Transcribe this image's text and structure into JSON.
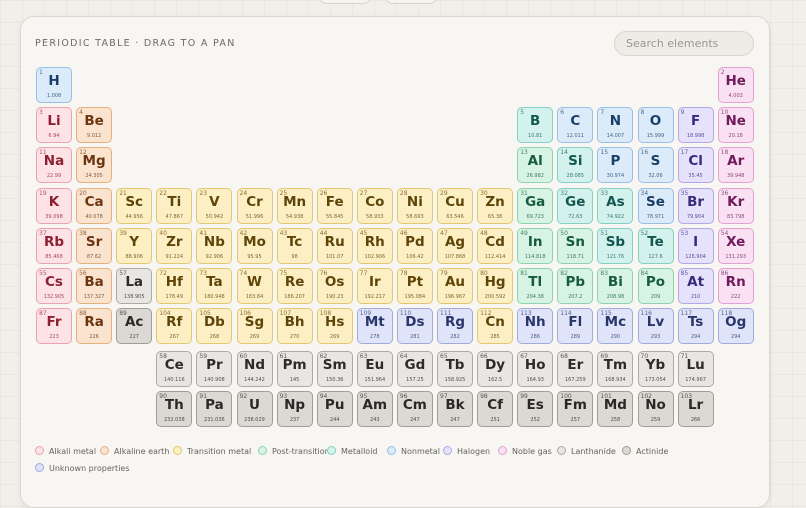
{
  "panel": {
    "title": "PERIODIC TABLE · DRAG TO A PAN"
  },
  "search": {
    "placeholder": "Search elements"
  },
  "categories": {
    "alkali": {
      "label": "Alkali metal",
      "bg": "#fde3e6",
      "border": "#eba3ad",
      "text": "#8f1f33"
    },
    "alkaline": {
      "label": "Alkaline earth",
      "bg": "#fbe4cf",
      "border": "#e3b07f",
      "text": "#6a3510"
    },
    "transition": {
      "label": "Transition metal",
      "bg": "#fbefc3",
      "border": "#e2c874",
      "text": "#5f4408"
    },
    "post": {
      "label": "Post-transition",
      "bg": "#d6f3e3",
      "border": "#8fd3ad",
      "text": "#175c3a"
    },
    "metalloid": {
      "label": "Metalloid",
      "bg": "#d3f2ed",
      "border": "#85cfc3",
      "text": "#135650"
    },
    "nonmetal": {
      "label": "Nonmetal",
      "bg": "#dcebfa",
      "border": "#99bfe3",
      "text": "#1a3f66"
    },
    "halogen": {
      "label": "Halogen",
      "bg": "#e6e2fb",
      "border": "#b1a6e6",
      "text": "#392a7c"
    },
    "noble": {
      "label": "Noble gas",
      "bg": "#f9e1f3",
      "border": "#e0a2d1",
      "text": "#701a5c"
    },
    "lanthanide": {
      "label": "Lanthanide",
      "bg": "#e8e6e2",
      "border": "#aeaaa3",
      "text": "#2d2b28"
    },
    "actinide": {
      "label": "Actinide",
      "bg": "#dcd9d4",
      "border": "#a19d96",
      "text": "#2a2825"
    },
    "unknown": {
      "label": "Unknown properties",
      "bg": "#dfe4f8",
      "border": "#9eabdc",
      "text": "#29366c"
    }
  },
  "legend_order": [
    "alkali",
    "alkaline",
    "transition",
    "post",
    "metalloid",
    "nonmetal",
    "halogen",
    "noble",
    "lanthanide",
    "actinide",
    "unknown"
  ],
  "elements": [
    {
      "n": "1",
      "s": "H",
      "m": "1.008",
      "c": "nonmetal",
      "g": 1,
      "p": 1
    },
    {
      "n": "2",
      "s": "He",
      "m": "4.003",
      "c": "noble",
      "g": 18,
      "p": 1
    },
    {
      "n": "3",
      "s": "Li",
      "m": "6.94",
      "c": "alkali",
      "g": 1,
      "p": 2
    },
    {
      "n": "4",
      "s": "Be",
      "m": "9.012",
      "c": "alkaline",
      "g": 2,
      "p": 2
    },
    {
      "n": "5",
      "s": "B",
      "m": "10.81",
      "c": "metalloid",
      "g": 13,
      "p": 2
    },
    {
      "n": "6",
      "s": "C",
      "m": "12.011",
      "c": "nonmetal",
      "g": 14,
      "p": 2
    },
    {
      "n": "7",
      "s": "N",
      "m": "14.007",
      "c": "nonmetal",
      "g": 15,
      "p": 2
    },
    {
      "n": "8",
      "s": "O",
      "m": "15.999",
      "c": "nonmetal",
      "g": 16,
      "p": 2
    },
    {
      "n": "9",
      "s": "F",
      "m": "18.998",
      "c": "halogen",
      "g": 17,
      "p": 2
    },
    {
      "n": "10",
      "s": "Ne",
      "m": "20.18",
      "c": "noble",
      "g": 18,
      "p": 2
    },
    {
      "n": "11",
      "s": "Na",
      "m": "22.99",
      "c": "alkali",
      "g": 1,
      "p": 3
    },
    {
      "n": "12",
      "s": "Mg",
      "m": "24.305",
      "c": "alkaline",
      "g": 2,
      "p": 3
    },
    {
      "n": "13",
      "s": "Al",
      "m": "26.982",
      "c": "post",
      "g": 13,
      "p": 3
    },
    {
      "n": "14",
      "s": "Si",
      "m": "28.085",
      "c": "metalloid",
      "g": 14,
      "p": 3
    },
    {
      "n": "15",
      "s": "P",
      "m": "30.974",
      "c": "nonmetal",
      "g": 15,
      "p": 3
    },
    {
      "n": "16",
      "s": "S",
      "m": "32.06",
      "c": "nonmetal",
      "g": 16,
      "p": 3
    },
    {
      "n": "17",
      "s": "Cl",
      "m": "35.45",
      "c": "halogen",
      "g": 17,
      "p": 3
    },
    {
      "n": "18",
      "s": "Ar",
      "m": "39.948",
      "c": "noble",
      "g": 18,
      "p": 3
    },
    {
      "n": "19",
      "s": "K",
      "m": "39.098",
      "c": "alkali",
      "g": 1,
      "p": 4
    },
    {
      "n": "20",
      "s": "Ca",
      "m": "40.078",
      "c": "alkaline",
      "g": 2,
      "p": 4
    },
    {
      "n": "21",
      "s": "Sc",
      "m": "44.956",
      "c": "transition",
      "g": 3,
      "p": 4
    },
    {
      "n": "22",
      "s": "Ti",
      "m": "47.867",
      "c": "transition",
      "g": 4,
      "p": 4
    },
    {
      "n": "23",
      "s": "V",
      "m": "50.942",
      "c": "transition",
      "g": 5,
      "p": 4
    },
    {
      "n": "24",
      "s": "Cr",
      "m": "51.996",
      "c": "transition",
      "g": 6,
      "p": 4
    },
    {
      "n": "25",
      "s": "Mn",
      "m": "54.938",
      "c": "transition",
      "g": 7,
      "p": 4
    },
    {
      "n": "26",
      "s": "Fe",
      "m": "55.845",
      "c": "transition",
      "g": 8,
      "p": 4
    },
    {
      "n": "27",
      "s": "Co",
      "m": "58.933",
      "c": "transition",
      "g": 9,
      "p": 4
    },
    {
      "n": "28",
      "s": "Ni",
      "m": "58.693",
      "c": "transition",
      "g": 10,
      "p": 4
    },
    {
      "n": "29",
      "s": "Cu",
      "m": "63.546",
      "c": "transition",
      "g": 11,
      "p": 4
    },
    {
      "n": "30",
      "s": "Zn",
      "m": "65.38",
      "c": "transition",
      "g": 12,
      "p": 4
    },
    {
      "n": "31",
      "s": "Ga",
      "m": "69.723",
      "c": "post",
      "g": 13,
      "p": 4
    },
    {
      "n": "32",
      "s": "Ge",
      "m": "72.63",
      "c": "metalloid",
      "g": 14,
      "p": 4
    },
    {
      "n": "33",
      "s": "As",
      "m": "74.922",
      "c": "metalloid",
      "g": 15,
      "p": 4
    },
    {
      "n": "34",
      "s": "Se",
      "m": "78.971",
      "c": "nonmetal",
      "g": 16,
      "p": 4
    },
    {
      "n": "35",
      "s": "Br",
      "m": "79.904",
      "c": "halogen",
      "g": 17,
      "p": 4
    },
    {
      "n": "36",
      "s": "Kr",
      "m": "83.798",
      "c": "noble",
      "g": 18,
      "p": 4
    },
    {
      "n": "37",
      "s": "Rb",
      "m": "85.468",
      "c": "alkali",
      "g": 1,
      "p": 5
    },
    {
      "n": "38",
      "s": "Sr",
      "m": "87.62",
      "c": "alkaline",
      "g": 2,
      "p": 5
    },
    {
      "n": "39",
      "s": "Y",
      "m": "88.906",
      "c": "transition",
      "g": 3,
      "p": 5
    },
    {
      "n": "40",
      "s": "Zr",
      "m": "91.224",
      "c": "transition",
      "g": 4,
      "p": 5
    },
    {
      "n": "41",
      "s": "Nb",
      "m": "92.906",
      "c": "transition",
      "g": 5,
      "p": 5
    },
    {
      "n": "42",
      "s": "Mo",
      "m": "95.95",
      "c": "transition",
      "g": 6,
      "p": 5
    },
    {
      "n": "43",
      "s": "Tc",
      "m": "98",
      "c": "transition",
      "g": 7,
      "p": 5
    },
    {
      "n": "44",
      "s": "Ru",
      "m": "101.07",
      "c": "transition",
      "g": 8,
      "p": 5
    },
    {
      "n": "45",
      "s": "Rh",
      "m": "102.906",
      "c": "transition",
      "g": 9,
      "p": 5
    },
    {
      "n": "46",
      "s": "Pd",
      "m": "106.42",
      "c": "transition",
      "g": 10,
      "p": 5
    },
    {
      "n": "47",
      "s": "Ag",
      "m": "107.868",
      "c": "transition",
      "g": 11,
      "p": 5
    },
    {
      "n": "48",
      "s": "Cd",
      "m": "112.414",
      "c": "transition",
      "g": 12,
      "p": 5
    },
    {
      "n": "49",
      "s": "In",
      "m": "114.818",
      "c": "post",
      "g": 13,
      "p": 5
    },
    {
      "n": "50",
      "s": "Sn",
      "m": "118.71",
      "c": "post",
      "g": 14,
      "p": 5
    },
    {
      "n": "51",
      "s": "Sb",
      "m": "121.76",
      "c": "metalloid",
      "g": 15,
      "p": 5
    },
    {
      "n": "52",
      "s": "Te",
      "m": "127.6",
      "c": "metalloid",
      "g": 16,
      "p": 5
    },
    {
      "n": "53",
      "s": "I",
      "m": "126.904",
      "c": "halogen",
      "g": 17,
      "p": 5
    },
    {
      "n": "54",
      "s": "Xe",
      "m": "131.293",
      "c": "noble",
      "g": 18,
      "p": 5
    },
    {
      "n": "55",
      "s": "Cs",
      "m": "132.905",
      "c": "alkali",
      "g": 1,
      "p": 6
    },
    {
      "n": "56",
      "s": "Ba",
      "m": "137.327",
      "c": "alkaline",
      "g": 2,
      "p": 6
    },
    {
      "n": "57",
      "s": "La",
      "m": "138.905",
      "c": "lanthanide",
      "g": 3,
      "p": 6
    },
    {
      "n": "72",
      "s": "Hf",
      "m": "178.49",
      "c": "transition",
      "g": 4,
      "p": 6
    },
    {
      "n": "73",
      "s": "Ta",
      "m": "180.948",
      "c": "transition",
      "g": 5,
      "p": 6
    },
    {
      "n": "74",
      "s": "W",
      "m": "183.84",
      "c": "transition",
      "g": 6,
      "p": 6
    },
    {
      "n": "75",
      "s": "Re",
      "m": "186.207",
      "c": "transition",
      "g": 7,
      "p": 6
    },
    {
      "n": "76",
      "s": "Os",
      "m": "190.23",
      "c": "transition",
      "g": 8,
      "p": 6
    },
    {
      "n": "77",
      "s": "Ir",
      "m": "192.217",
      "c": "transition",
      "g": 9,
      "p": 6
    },
    {
      "n": "78",
      "s": "Pt",
      "m": "195.084",
      "c": "transition",
      "g": 10,
      "p": 6
    },
    {
      "n": "79",
      "s": "Au",
      "m": "196.967",
      "c": "transition",
      "g": 11,
      "p": 6
    },
    {
      "n": "80",
      "s": "Hg",
      "m": "200.592",
      "c": "transition",
      "g": 12,
      "p": 6
    },
    {
      "n": "81",
      "s": "Tl",
      "m": "204.38",
      "c": "post",
      "g": 13,
      "p": 6
    },
    {
      "n": "82",
      "s": "Pb",
      "m": "207.2",
      "c": "post",
      "g": 14,
      "p": 6
    },
    {
      "n": "83",
      "s": "Bi",
      "m": "208.98",
      "c": "post",
      "g": 15,
      "p": 6
    },
    {
      "n": "84",
      "s": "Po",
      "m": "209",
      "c": "post",
      "g": 16,
      "p": 6
    },
    {
      "n": "85",
      "s": "At",
      "m": "210",
      "c": "halogen",
      "g": 17,
      "p": 6
    },
    {
      "n": "86",
      "s": "Rn",
      "m": "222",
      "c": "noble",
      "g": 18,
      "p": 6
    },
    {
      "n": "87",
      "s": "Fr",
      "m": "223",
      "c": "alkali",
      "g": 1,
      "p": 7
    },
    {
      "n": "88",
      "s": "Ra",
      "m": "226",
      "c": "alkaline",
      "g": 2,
      "p": 7
    },
    {
      "n": "89",
      "s": "Ac",
      "m": "227",
      "c": "actinide",
      "g": 3,
      "p": 7
    },
    {
      "n": "104",
      "s": "Rf",
      "m": "267",
      "c": "transition",
      "g": 4,
      "p": 7
    },
    {
      "n": "105",
      "s": "Db",
      "m": "268",
      "c": "transition",
      "g": 5,
      "p": 7
    },
    {
      "n": "106",
      "s": "Sg",
      "m": "269",
      "c": "transition",
      "g": 6,
      "p": 7
    },
    {
      "n": "107",
      "s": "Bh",
      "m": "270",
      "c": "transition",
      "g": 7,
      "p": 7
    },
    {
      "n": "108",
      "s": "Hs",
      "m": "269",
      "c": "transition",
      "g": 8,
      "p": 7
    },
    {
      "n": "109",
      "s": "Mt",
      "m": "278",
      "c": "unknown",
      "g": 9,
      "p": 7
    },
    {
      "n": "110",
      "s": "Ds",
      "m": "281",
      "c": "unknown",
      "g": 10,
      "p": 7
    },
    {
      "n": "111",
      "s": "Rg",
      "m": "282",
      "c": "unknown",
      "g": 11,
      "p": 7
    },
    {
      "n": "112",
      "s": "Cn",
      "m": "285",
      "c": "transition",
      "g": 12,
      "p": 7
    },
    {
      "n": "113",
      "s": "Nh",
      "m": "286",
      "c": "unknown",
      "g": 13,
      "p": 7
    },
    {
      "n": "114",
      "s": "Fl",
      "m": "289",
      "c": "unknown",
      "g": 14,
      "p": 7
    },
    {
      "n": "115",
      "s": "Mc",
      "m": "290",
      "c": "unknown",
      "g": 15,
      "p": 7
    },
    {
      "n": "116",
      "s": "Lv",
      "m": "293",
      "c": "unknown",
      "g": 16,
      "p": 7
    },
    {
      "n": "117",
      "s": "Ts",
      "m": "294",
      "c": "unknown",
      "g": 17,
      "p": 7
    },
    {
      "n": "118",
      "s": "Og",
      "m": "294",
      "c": "unknown",
      "g": 18,
      "p": 7
    },
    {
      "n": "58",
      "s": "Ce",
      "m": "140.116",
      "c": "lanthanide",
      "g": 4,
      "p": 8
    },
    {
      "n": "59",
      "s": "Pr",
      "m": "140.908",
      "c": "lanthanide",
      "g": 5,
      "p": 8
    },
    {
      "n": "60",
      "s": "Nd",
      "m": "144.242",
      "c": "lanthanide",
      "g": 6,
      "p": 8
    },
    {
      "n": "61",
      "s": "Pm",
      "m": "145",
      "c": "lanthanide",
      "g": 7,
      "p": 8
    },
    {
      "n": "62",
      "s": "Sm",
      "m": "150.36",
      "c": "lanthanide",
      "g": 8,
      "p": 8
    },
    {
      "n": "63",
      "s": "Eu",
      "m": "151.964",
      "c": "lanthanide",
      "g": 9,
      "p": 8
    },
    {
      "n": "64",
      "s": "Gd",
      "m": "157.25",
      "c": "lanthanide",
      "g": 10,
      "p": 8
    },
    {
      "n": "65",
      "s": "Tb",
      "m": "158.925",
      "c": "lanthanide",
      "g": 11,
      "p": 8
    },
    {
      "n": "66",
      "s": "Dy",
      "m": "162.5",
      "c": "lanthanide",
      "g": 12,
      "p": 8
    },
    {
      "n": "67",
      "s": "Ho",
      "m": "164.93",
      "c": "lanthanide",
      "g": 13,
      "p": 8
    },
    {
      "n": "68",
      "s": "Er",
      "m": "167.259",
      "c": "lanthanide",
      "g": 14,
      "p": 8
    },
    {
      "n": "69",
      "s": "Tm",
      "m": "168.934",
      "c": "lanthanide",
      "g": 15,
      "p": 8
    },
    {
      "n": "70",
      "s": "Yb",
      "m": "173.054",
      "c": "lanthanide",
      "g": 16,
      "p": 8
    },
    {
      "n": "71",
      "s": "Lu",
      "m": "174.967",
      "c": "lanthanide",
      "g": 17,
      "p": 8
    },
    {
      "n": "90",
      "s": "Th",
      "m": "232.038",
      "c": "actinide",
      "g": 4,
      "p": 9
    },
    {
      "n": "91",
      "s": "Pa",
      "m": "231.036",
      "c": "actinide",
      "g": 5,
      "p": 9
    },
    {
      "n": "92",
      "s": "U",
      "m": "238.029",
      "c": "actinide",
      "g": 6,
      "p": 9
    },
    {
      "n": "93",
      "s": "Np",
      "m": "237",
      "c": "actinide",
      "g": 7,
      "p": 9
    },
    {
      "n": "94",
      "s": "Pu",
      "m": "244",
      "c": "actinide",
      "g": 8,
      "p": 9
    },
    {
      "n": "95",
      "s": "Am",
      "m": "243",
      "c": "actinide",
      "g": 9,
      "p": 9
    },
    {
      "n": "96",
      "s": "Cm",
      "m": "247",
      "c": "actinide",
      "g": 10,
      "p": 9
    },
    {
      "n": "97",
      "s": "Bk",
      "m": "247",
      "c": "actinide",
      "g": 11,
      "p": 9
    },
    {
      "n": "98",
      "s": "Cf",
      "m": "251",
      "c": "actinide",
      "g": 12,
      "p": 9
    },
    {
      "n": "99",
      "s": "Es",
      "m": "252",
      "c": "actinide",
      "g": 13,
      "p": 9
    },
    {
      "n": "100",
      "s": "Fm",
      "m": "257",
      "c": "actinide",
      "g": 14,
      "p": 9
    },
    {
      "n": "101",
      "s": "Md",
      "m": "258",
      "c": "actinide",
      "g": 15,
      "p": 9
    },
    {
      "n": "102",
      "s": "No",
      "m": "259",
      "c": "actinide",
      "g": 16,
      "p": 9
    },
    {
      "n": "103",
      "s": "Lr",
      "m": "266",
      "c": "actinide",
      "g": 17,
      "p": 9
    }
  ]
}
